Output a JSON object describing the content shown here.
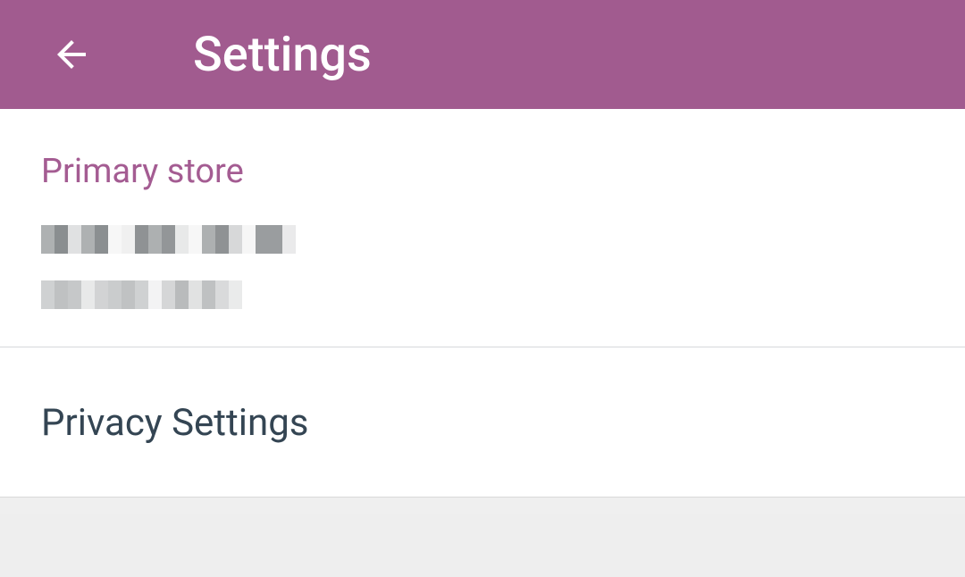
{
  "header": {
    "title": "Settings"
  },
  "primary_store": {
    "section_label": "Primary store",
    "line1_obscured": true,
    "line2_obscured": true
  },
  "privacy": {
    "label": "Privacy Settings"
  },
  "colors": {
    "accent": "#a15b8f",
    "text_dark": "#344553"
  }
}
